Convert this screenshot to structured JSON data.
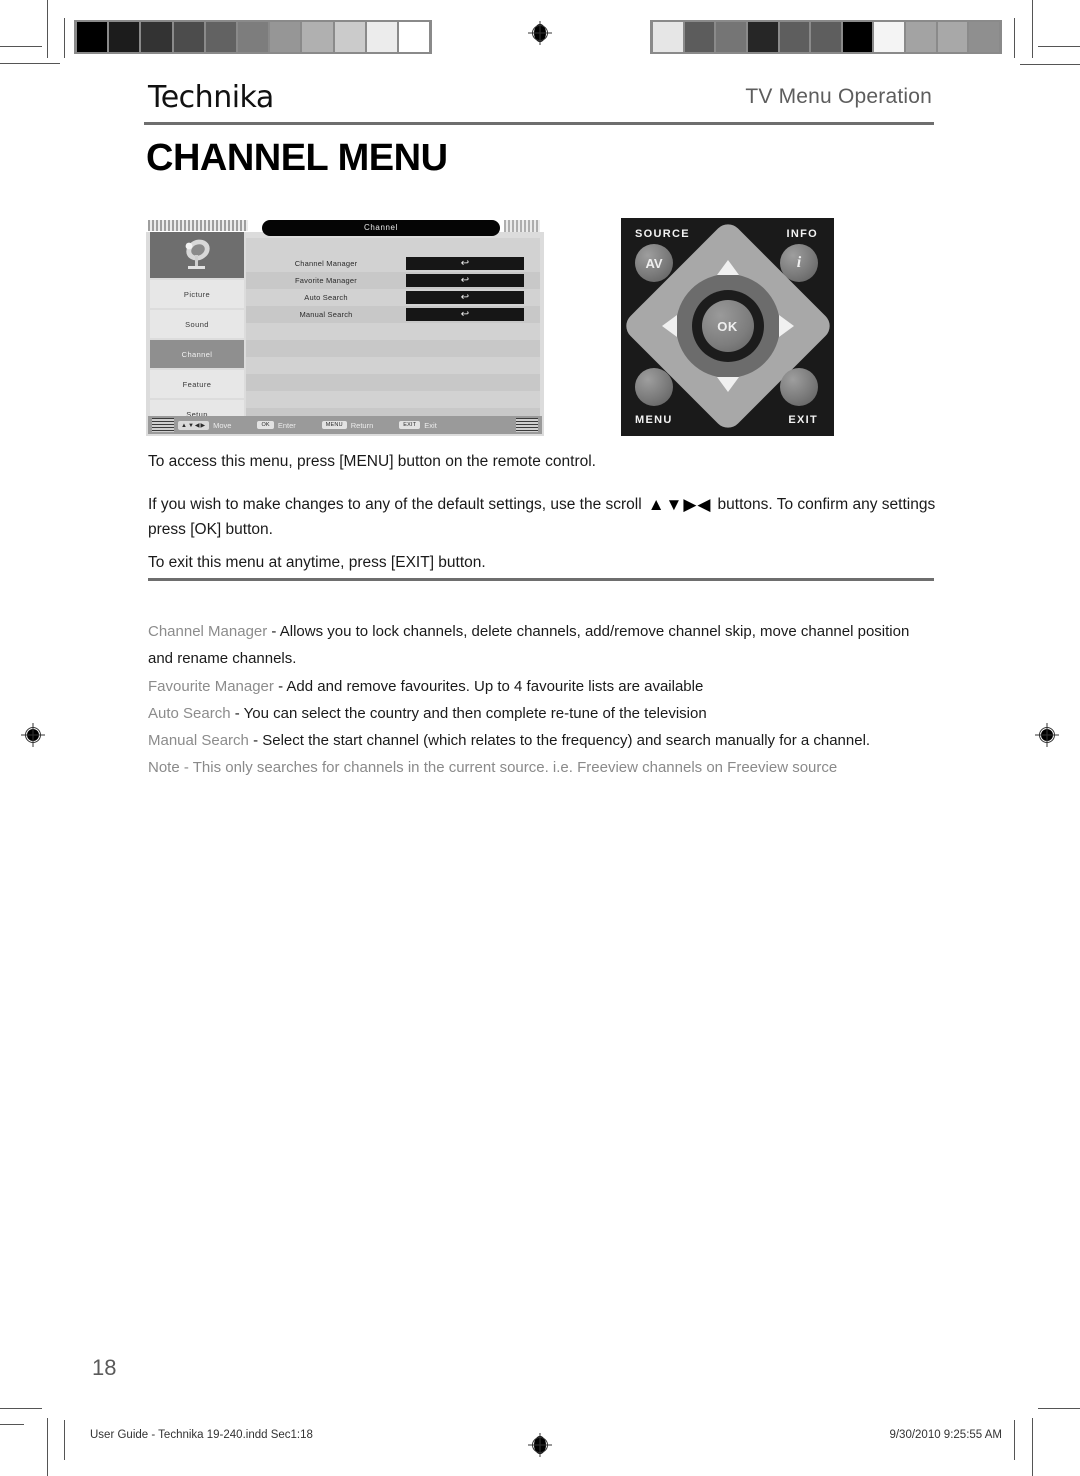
{
  "header": {
    "brand": "Technika",
    "section": "TV Menu Operation",
    "page_heading": "CHANNEL MENU"
  },
  "osd": {
    "title": "Channel",
    "sidebar": [
      {
        "label": "Picture",
        "active": false
      },
      {
        "label": "Sound",
        "active": false
      },
      {
        "label": "Channel",
        "active": true
      },
      {
        "label": "Feature",
        "active": false
      },
      {
        "label": "Setup",
        "active": false
      }
    ],
    "rows": [
      {
        "label": "Channel Manager",
        "control": "enter-arrow"
      },
      {
        "label": "Favorite Manager",
        "control": "enter-arrow"
      },
      {
        "label": "Auto Search",
        "control": "enter-arrow"
      },
      {
        "label": "Manual Search",
        "control": "enter-arrow"
      }
    ],
    "enter_glyph": "↩",
    "bottom_bar": [
      {
        "key": "▲▼◀▶",
        "action": "Move",
        "key_style": "arrows"
      },
      {
        "key": "OK",
        "action": "Enter",
        "key_style": "key"
      },
      {
        "key": "MENU",
        "action": "Return",
        "key_style": "key"
      },
      {
        "key": "EXIT",
        "action": "Exit",
        "key_style": "key"
      }
    ]
  },
  "remote": {
    "source_label": "SOURCE",
    "info_label": "INFO",
    "menu_label": "MENU",
    "exit_label": "EXIT",
    "av_button": "AV",
    "info_button": "i",
    "ok_button": "OK"
  },
  "intro": {
    "line1": "To access this menu, press [MENU] button on the remote control.",
    "line2_pre": "If you wish to make changes to any of the default settings, use the scroll",
    "line2_arrows": "▲▼▶◀",
    "line2_post": "buttons. To confirm any settings press [OK] button.",
    "line3": "To exit this menu at anytime, press [EXIT] button."
  },
  "descriptions": [
    {
      "term": "Channel Manager",
      "dash": " - ",
      "text": "Allows you to lock channels, delete channels, add/remove channel skip, move channel position and rename channels."
    },
    {
      "term": "Favourite Manager",
      "dash": " - ",
      "text": "Add and remove favourites. Up to 4 favourite lists are available"
    },
    {
      "term": "Auto Search",
      "dash": " - ",
      "text": "You can select the country and then complete re-tune of the television"
    },
    {
      "term": "Manual Search",
      "dash": " - ",
      "text": "Select the start channel (which relates to the frequency) and search manually for a channel."
    }
  ],
  "note": "Note - This only searches for channels in the current source. i.e. Freeview channels on Freeview source",
  "footer": {
    "page_number": "18",
    "left": "User Guide - Technika 19-240.indd   Sec1:18",
    "right": "9/30/2010   9:25:55 AM"
  },
  "calibration": {
    "left_bar": [
      "#000000",
      "#1c1c1c",
      "#333333",
      "#4c4c4c",
      "#626262",
      "#7d7d7d",
      "#969696",
      "#b0b0b0",
      "#cbcbcb",
      "#ececec",
      "#ffffff"
    ],
    "right_bar": [
      "#e6e6e6",
      "#5c5c5c",
      "#757575",
      "#262626",
      "#5e5e5e",
      "#5e5e5e",
      "#000000",
      "#f4f4f4",
      "#a3a3a3",
      "#a8a8a8",
      "#8f8f8f"
    ]
  }
}
